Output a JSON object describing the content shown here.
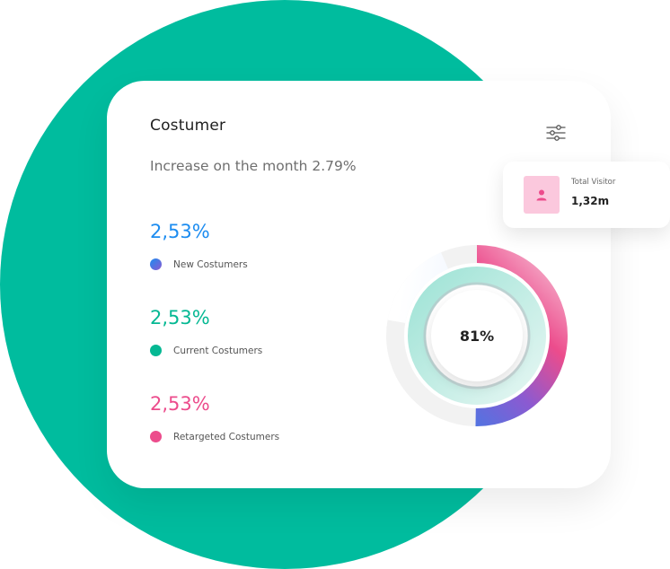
{
  "card": {
    "title": "Costumer",
    "subtitle": "Increase on the month 2.79%",
    "filter_icon": "sliders-icon"
  },
  "stats": [
    {
      "value": "2,53%",
      "label": "New Costumers",
      "color": "#1c8cf0",
      "dot": "gradient blue-purple"
    },
    {
      "value": "2,53%",
      "label": "Current Costumers",
      "color": "#05b893",
      "dot": "#05b893"
    },
    {
      "value": "2,53%",
      "label": "Retargeted Costumers",
      "color": "#ec4c8c",
      "dot": "#ec4c8c"
    }
  ],
  "donut": {
    "center_label": "81%",
    "percent": 81,
    "colors": {
      "blue": "#1c8cf0",
      "purple": "#8b5ad1",
      "pink": "#ec4c8c",
      "teal": "#3dcbb1"
    }
  },
  "visitor": {
    "label": "Total Visitor",
    "value": "1,32m",
    "icon": "user-icon",
    "icon_bg": "#fbc8dd",
    "icon_color": "#ec4c8c"
  },
  "colors": {
    "background_circle": "#00bc9e"
  }
}
